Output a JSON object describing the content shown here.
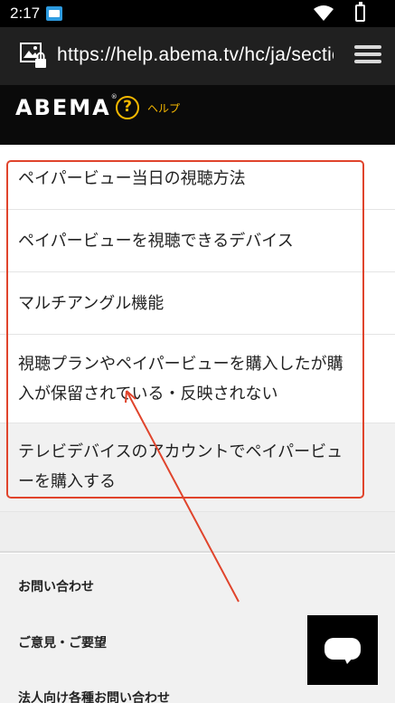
{
  "status_bar": {
    "time": "2:17",
    "app_icon": "abema-notification-icon",
    "wifi_icon": "wifi-icon",
    "battery_icon": "battery-icon"
  },
  "browser": {
    "url": "https://help.abema.tv/hc/ja/sections",
    "site_icon": "site-info-icon",
    "tabs_icon": "tabs-menu-icon"
  },
  "header": {
    "logo": "ABEMA",
    "logo_mark": "®",
    "help_icon_glyph": "?",
    "help_label": "ヘルプ",
    "accent_color": "#f5b800"
  },
  "articles": [
    {
      "lines": [
        "ペイパービュー当日の視聴方法"
      ]
    },
    {
      "lines": [
        "ペイパービューを視聴できるデバイス"
      ]
    },
    {
      "lines": [
        "マルチアングル機能"
      ]
    },
    {
      "lines": [
        "視聴プランやペイパービューを購入したが購",
        "入が保留されている・反映されない"
      ]
    },
    {
      "lines": [
        "テレビデバイスのアカウントでペイパービュ",
        "ーを購入する"
      ]
    }
  ],
  "footer": {
    "links": [
      "お問い合わせ",
      "ご意見・ご要望",
      "法人向け各種お問い合わせ"
    ]
  },
  "chat": {
    "icon": "chat-icon"
  },
  "annotation_color": "#e0442c"
}
